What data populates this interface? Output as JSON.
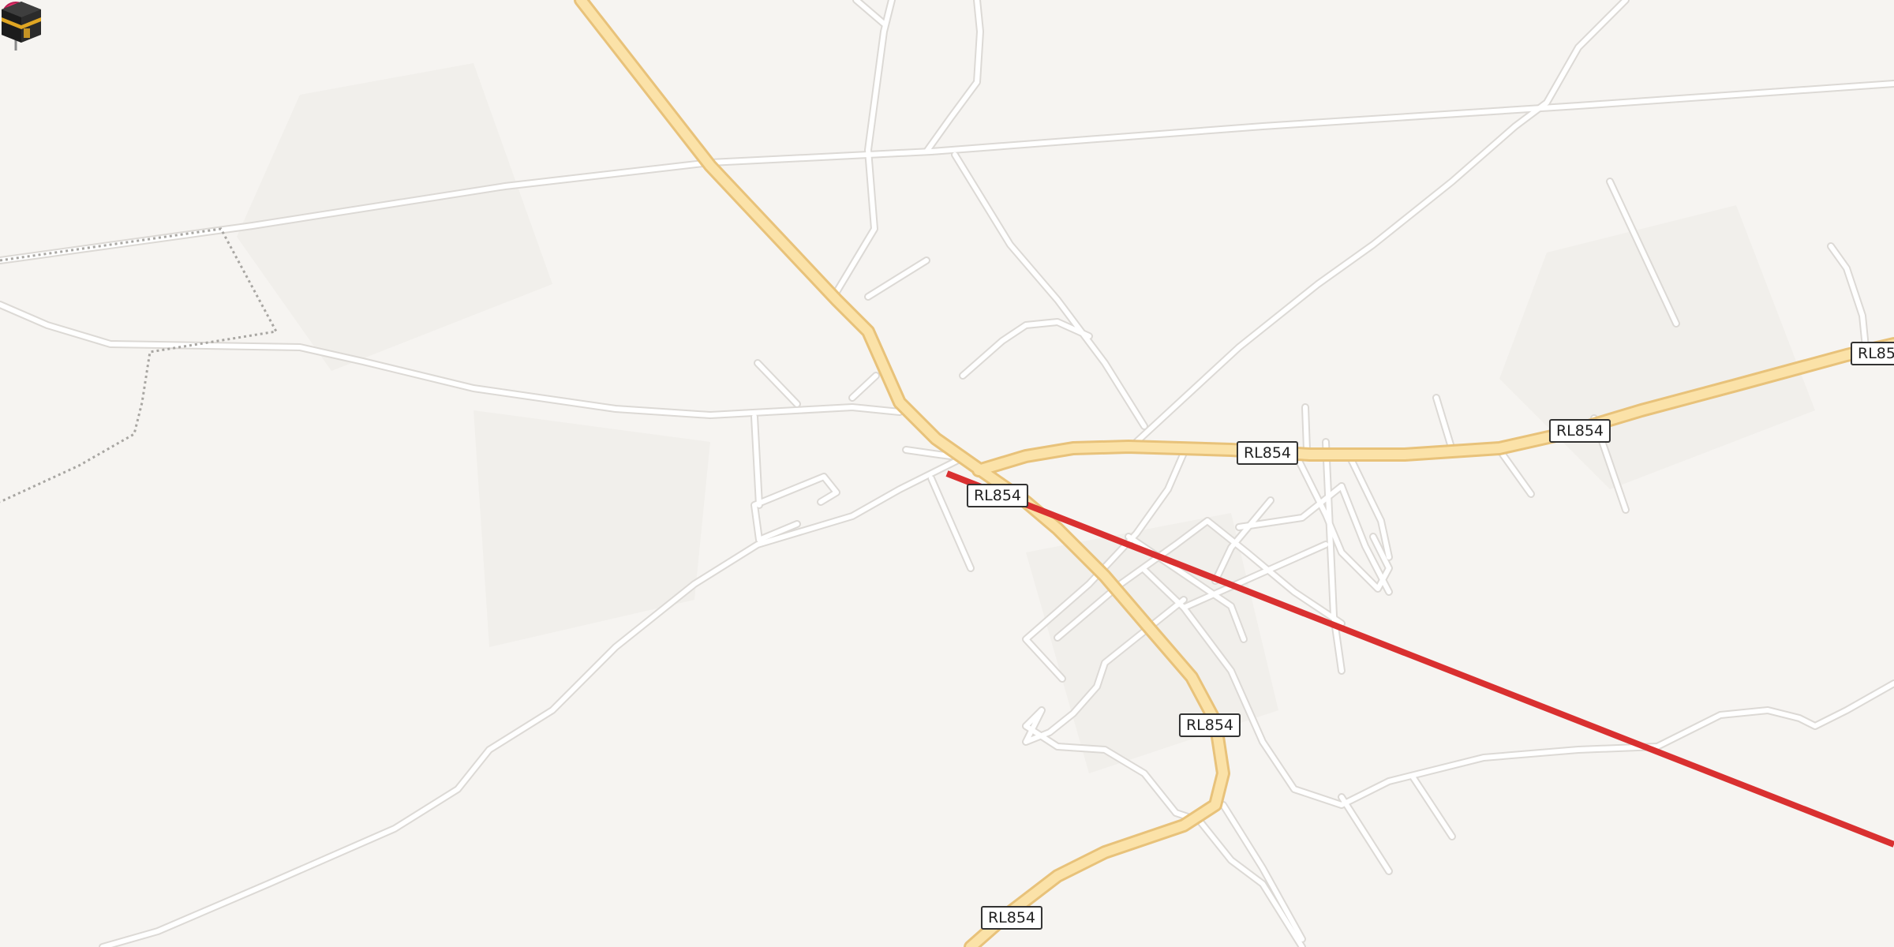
{
  "map": {
    "road_labels": [
      "RL854",
      "RL854",
      "RL854",
      "RL854",
      "RL854",
      "RL85"
    ],
    "route_color": "#d93030",
    "main_road_color": "#f7dc9c",
    "background_color": "#f6f4f1",
    "markers": {
      "location_pin": "map-pin-icon",
      "destination": "kaaba-icon"
    }
  }
}
